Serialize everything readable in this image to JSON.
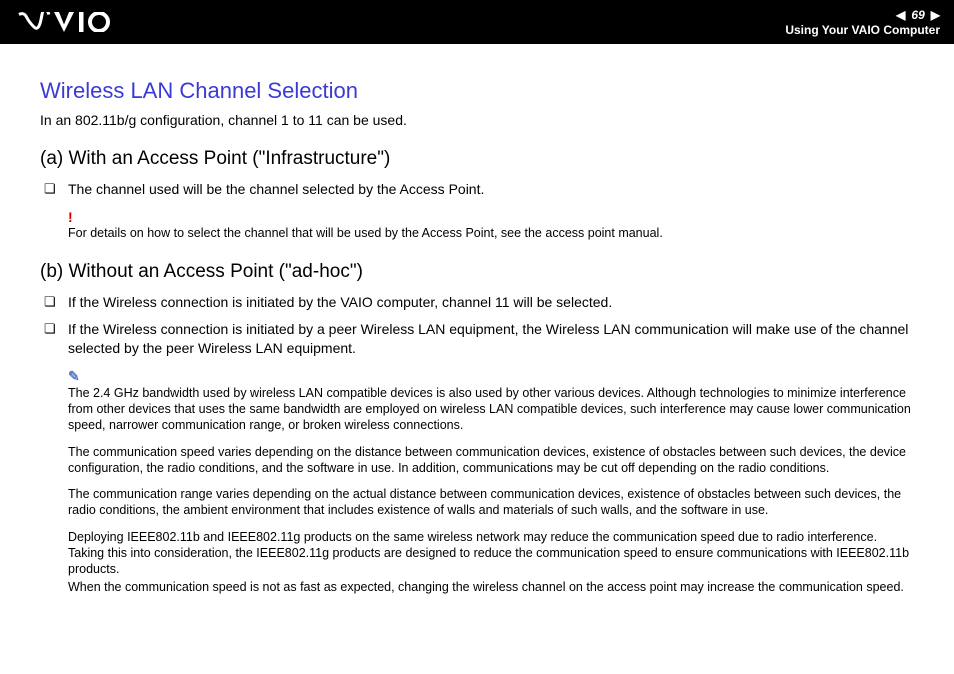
{
  "header": {
    "page_number": "69",
    "section_title": "Using Your VAIO Computer"
  },
  "main_heading": "Wireless LAN Channel Selection",
  "intro": "In an 802.11b/g configuration, channel 1 to 11 can be used.",
  "section_a": {
    "heading": "(a) With an Access Point (\"Infrastructure\")",
    "bullets": [
      "The channel used will be the channel selected by the Access Point."
    ],
    "warn_note": "For details on how to select the channel that will be used by the Access Point, see the access point manual."
  },
  "section_b": {
    "heading": "(b) Without an Access Point (\"ad-hoc\")",
    "bullets": [
      "If the Wireless connection is initiated by the VAIO computer, channel 11 will be selected.",
      "If the Wireless connection is initiated by a peer Wireless LAN equipment, the Wireless LAN communication will make use of the channel selected by the peer Wireless LAN equipment."
    ],
    "info_note_p1": "The 2.4 GHz bandwidth used by wireless LAN compatible devices is also used by other various devices. Although technologies to minimize interference from other devices that uses the same bandwidth are employed on wireless LAN compatible devices, such interference may cause lower communication speed, narrower communication range, or broken wireless connections.",
    "info_note_p2": "The communication speed varies depending on the distance between communication devices, existence of obstacles between such devices, the device configuration, the radio conditions, and the software in use. In addition, communications may be cut off depending on the radio conditions.",
    "info_note_p3": "The communication range varies depending on the actual distance between communication devices, existence of obstacles between such devices, the radio conditions, the ambient environment that includes existence of walls and materials of such walls, and the software in use.",
    "info_note_p4": "Deploying IEEE802.11b and IEEE802.11g products on the same wireless network may reduce the communication speed due to radio interference. Taking this into consideration, the IEEE802.11g products are designed to reduce the communication speed to ensure communications with IEEE802.11b products.",
    "info_note_p5": "When the communication speed is not as fast as expected, changing the wireless channel on the access point may increase the communication speed."
  }
}
